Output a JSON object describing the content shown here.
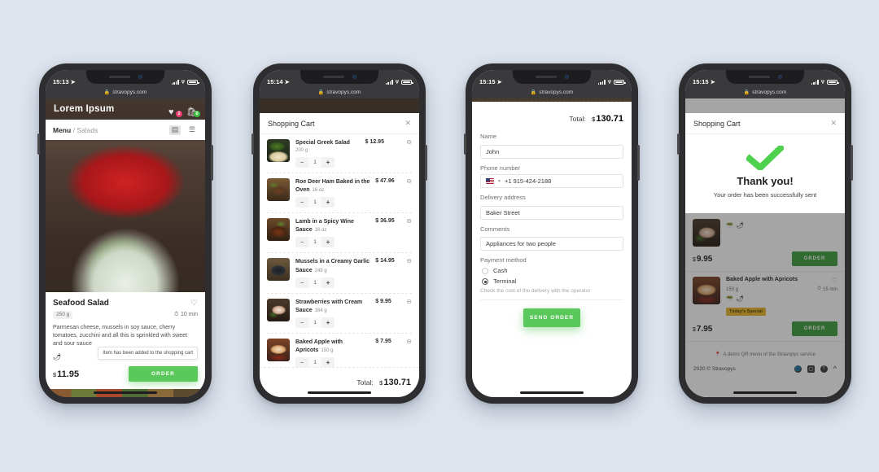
{
  "page": {
    "background_color": "#dfe5ee",
    "accent_green": "#5ac85a",
    "accent_green_dark": "#3f9e3f",
    "badge_pink": "#ef3a72",
    "special_yellow": "#e8b62c"
  },
  "phone1": {
    "status": {
      "time": "15:13",
      "location_icon": "location-arrow-icon"
    },
    "url": "stravopys.com",
    "header": {
      "brand": "Lorem Ipsum",
      "favorites_icon": "heart-icon",
      "favorites_count": "2",
      "cart_icon": "shopping-bag-icon",
      "cart_count": "6"
    },
    "breadcrumb": {
      "root": "Menu",
      "separator": "/",
      "current": "Salads"
    },
    "view_toggles": {
      "grid_icon": "grid-view-icon",
      "list_icon": "list-view-icon"
    },
    "dish": {
      "title": "Seafood Salad",
      "favorite_icon": "heart-outline-icon",
      "weight": "250 g",
      "time_icon": "stopwatch-icon",
      "time": "10 min",
      "description": "Parmesan cheese, mussels in soy sauce, cherry tomatoes, zucchini and all this is sprinkled with sweet and sour sauce",
      "tag_icons": [
        "chili-pepper-icon"
      ],
      "currency": "$",
      "price": "11.95",
      "order_label": "ORDER"
    },
    "toast": "Item has been added to the shopping cart"
  },
  "phone2": {
    "status": {
      "time": "15:14"
    },
    "url": "stravopys.com",
    "cart": {
      "title": "Shopping Cart",
      "close_icon": "close-icon",
      "items": [
        {
          "name": "Special Greek Salad",
          "weight": "200 g",
          "price": "$ 12.95",
          "qty": "1",
          "thumb": "th1"
        },
        {
          "name": "Roe Deer Ham Baked in the Oven",
          "weight": "16 oz",
          "price": "$ 47.96",
          "qty": "1",
          "thumb": "th2"
        },
        {
          "name": "Lamb in a Spicy Wine Sauce",
          "weight": "16 oz",
          "price": "$ 36.95",
          "qty": "1",
          "thumb": "th3"
        },
        {
          "name": "Mussels in a Creamy Garlic Sauce",
          "weight": "249 g",
          "price": "$ 14.95",
          "qty": "1",
          "thumb": "th4"
        },
        {
          "name": "Strawberries with Cream Sauce",
          "weight": "164 g",
          "price": "$ 9.95",
          "qty": "1",
          "thumb": "th5"
        },
        {
          "name": "Baked Apple with Apricots",
          "weight": "150 g",
          "price": "$ 7.95",
          "qty": "1",
          "thumb": "th6"
        }
      ],
      "total_label": "Total:",
      "total_currency": "$",
      "total_amount": "130.71",
      "minus_label": "−",
      "plus_label": "+"
    }
  },
  "phone3": {
    "status": {
      "time": "15:15"
    },
    "url": "stravopys.com",
    "checkout": {
      "total_label": "Total:",
      "total_currency": "$",
      "total_amount": "130.71",
      "name_label": "Name",
      "name_value": "John",
      "phone_label": "Phone number",
      "phone_value": "+1 915-424-2188",
      "flag_icon": "us-flag-icon",
      "address_label": "Delivery address",
      "address_value": "Baker Street",
      "comments_label": "Comments",
      "comments_value": "Appliances for two people",
      "payment_label": "Payment method",
      "payment_options": [
        {
          "label": "Cash",
          "selected": false
        },
        {
          "label": "Terminal",
          "selected": true
        }
      ],
      "hint": "Check the cost of the delivery with the operator",
      "send_label": "SEND ORDER"
    }
  },
  "phone4": {
    "status": {
      "time": "15:15"
    },
    "url": "stravopys.com",
    "modal": {
      "title": "Shopping Cart",
      "close_icon": "close-icon",
      "check_icon": "green-check-icon",
      "heading": "Thank you!",
      "subtext": "Your order has been successfully sent"
    },
    "background_items": [
      {
        "name": "",
        "weight": "",
        "time": "",
        "currency": "$",
        "price": "9.95",
        "order_label": "ORDER",
        "thumb": "th5",
        "tag_icons": [
          "salad-bowl-icon",
          "chili-pepper-icon"
        ],
        "special": ""
      },
      {
        "name": "Baked Apple with Apricots",
        "weight": "150 g",
        "time_icon": "stopwatch-icon",
        "time": "15 min",
        "favorite_icon": "heart-outline-icon",
        "currency": "$",
        "price": "7.95",
        "order_label": "ORDER",
        "thumb": "th6",
        "tag_icons": [
          "salad-bowl-icon",
          "chili-pepper-icon"
        ],
        "special": "Today's Special"
      }
    ],
    "footer": {
      "pin_icon": "map-pin-icon",
      "note": "A demo QR menu of the Stravopys service",
      "copyright": "2020 © Stravopys",
      "icons": [
        "globe-icon",
        "instagram-icon",
        "facebook-icon"
      ],
      "scroll_top_icon": "chevron-up-icon"
    }
  }
}
